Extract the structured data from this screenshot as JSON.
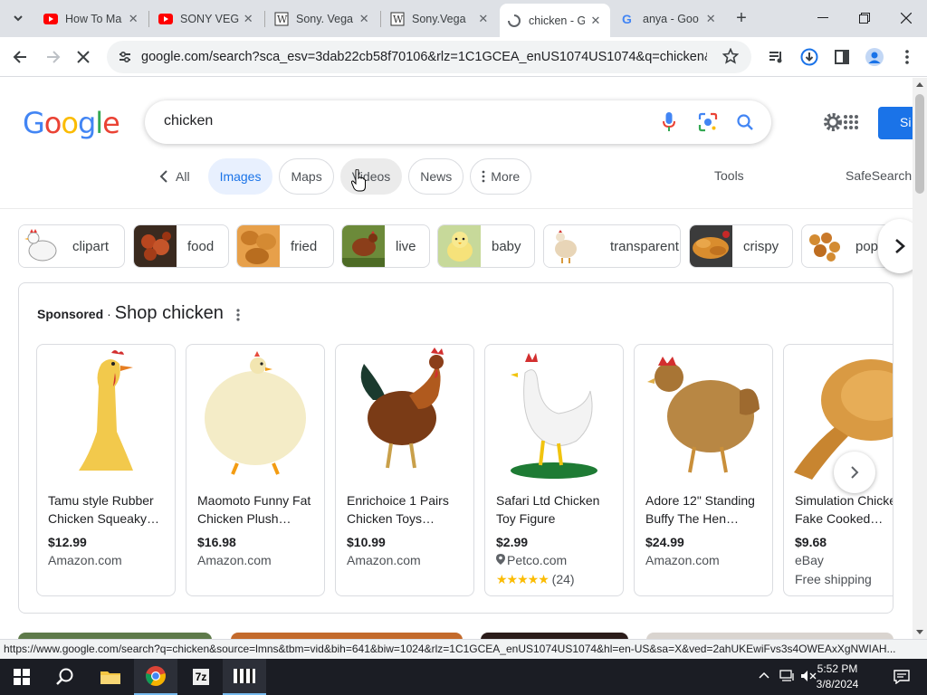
{
  "browser": {
    "tabs": [
      {
        "title": "How To Ma",
        "icon": "youtube-icon"
      },
      {
        "title": "SONY VEG",
        "icon": "youtube-icon"
      },
      {
        "title": "Sony. Vega",
        "icon": "wikipedia-icon"
      },
      {
        "title": "Sony.Vega",
        "icon": "wikipedia-icon"
      },
      {
        "title": "chicken - G",
        "icon": "google-loading-icon",
        "active": true
      },
      {
        "title": "anya - Goo",
        "icon": "google-icon"
      }
    ],
    "new_tab": "+",
    "url": "google.com/search?sca_esv=3dab22cb58f70106&rlz=1C1GCEA_enUS1074US1074&q=chicken&tbm..."
  },
  "google": {
    "logo": "Google",
    "query": "chicken",
    "signin": "Si",
    "nav": {
      "all": "All",
      "images": "Images",
      "maps": "Maps",
      "videos": "Videos",
      "news": "News",
      "more": "More",
      "tools": "Tools",
      "safesearch": "SafeSearch"
    },
    "refinements": [
      "clipart",
      "food",
      "fried",
      "live",
      "baby",
      "transparent",
      "crispy",
      "popc"
    ],
    "shopping": {
      "sponsored": "Sponsored",
      "sep": "·",
      "title": "Shop chicken",
      "products": [
        {
          "title": "Tamu style Rubber Chicken Squeaky…",
          "price": "$12.99",
          "store": "Amazon.com",
          "extra": ""
        },
        {
          "title": "Maomoto Funny Fat Chicken Plush…",
          "price": "$16.98",
          "store": "Amazon.com",
          "extra": ""
        },
        {
          "title": "Enrichoice 1 Pairs Chicken Toys…",
          "price": "$10.99",
          "store": "Amazon.com",
          "extra": ""
        },
        {
          "title": "Safari Ltd Chicken Toy Figure",
          "price": "$2.99",
          "store": "Petco.com",
          "extra": "(24)",
          "stars": 4.5
        },
        {
          "title": "Adore 12\" Standing Buffy The Hen…",
          "price": "$24.99",
          "store": "Amazon.com",
          "extra": ""
        },
        {
          "title": "Simulation Chicken Fake Cooked…",
          "price": "$9.68",
          "store": "eBay",
          "extra": "Free shipping"
        }
      ]
    }
  },
  "statusbar": {
    "url": "https://www.google.com/search?q=chicken&source=lmns&tbm=vid&bih=641&biw=1024&rlz=1C1GCEA_enUS1074US1074&hl=en-US&sa=X&ved=2ahUKEwiFvs3s4OWEAxXgNWIAH..."
  },
  "taskbar": {
    "time": "5:52 PM",
    "date": "3/8/2024",
    "app_7z": "7z"
  },
  "colors": {
    "accent": "#1a73e8",
    "chip_selected_bg": "#e8f0fe"
  }
}
